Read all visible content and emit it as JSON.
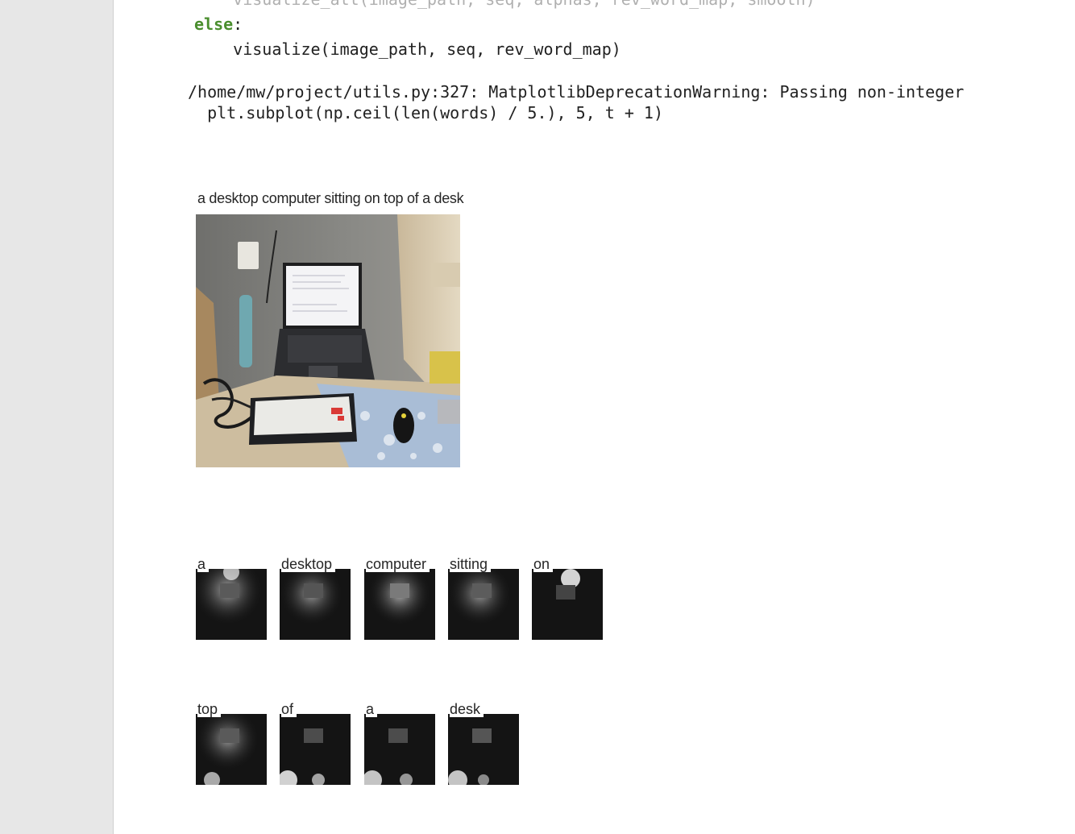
{
  "code": {
    "line_top": "    visualize_att(image_path, seq, alphas, rev_word_map, smooth)",
    "else_kw": "else",
    "else_colon": ":",
    "line_call": "    visualize(image_path, seq, rev_word_map)"
  },
  "output": {
    "warning_line": "/home/mw/project/utils.py:327: MatplotlibDeprecationWarning: Passing non-integer",
    "source_line": "  plt.subplot(np.ceil(len(words) / 5.), 5, t + 1)"
  },
  "figure": {
    "caption": "a desktop computer sitting on top of a desk"
  },
  "attention_words": {
    "row1": [
      "a",
      "desktop",
      "computer",
      "sitting",
      "on"
    ],
    "row2": [
      "top",
      "of",
      "a",
      "desk"
    ]
  },
  "colors": {
    "keyword": "#4a8e2e",
    "code_text": "#212121",
    "page_bg": "#ffffff",
    "gutter_bg": "#e7e7e7"
  }
}
